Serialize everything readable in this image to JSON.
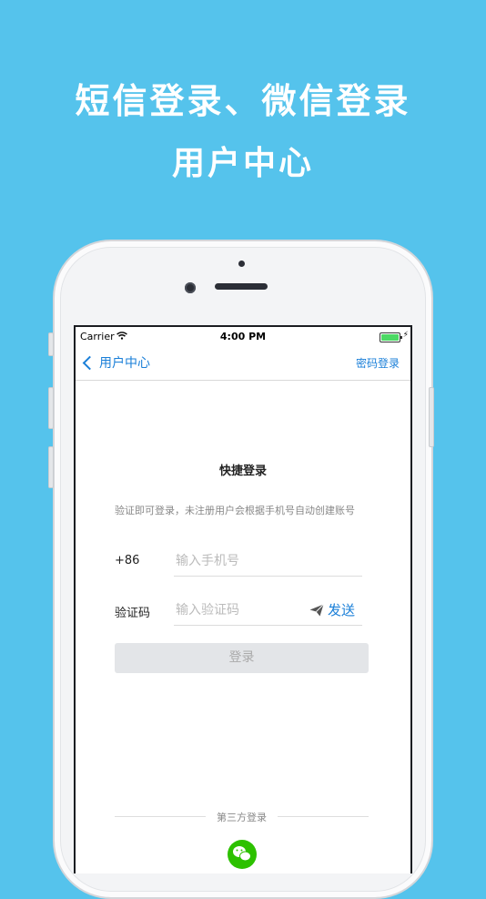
{
  "promo": {
    "line1": "短信登录、微信登录",
    "line2": "用户中心"
  },
  "status_bar": {
    "carrier": "Carrier",
    "time": "4:00 PM",
    "battery_color": "#4cd964"
  },
  "nav": {
    "back_label": "用户中心",
    "right_label": "密码登录"
  },
  "login": {
    "title": "快捷登录",
    "hint": "验证即可登录，未注册用户会根据手机号自动创建账号",
    "phone_prefix": "+86",
    "phone_placeholder": "输入手机号",
    "code_label": "验证码",
    "code_placeholder": "输入验证码",
    "send_label": "发送",
    "submit_label": "登录"
  },
  "third_party": {
    "label": "第三方登录",
    "icons": [
      "wechat-icon"
    ]
  },
  "colors": {
    "background": "#55c3ec",
    "accent": "#1a7fd8",
    "wechat": "#2dc100"
  }
}
